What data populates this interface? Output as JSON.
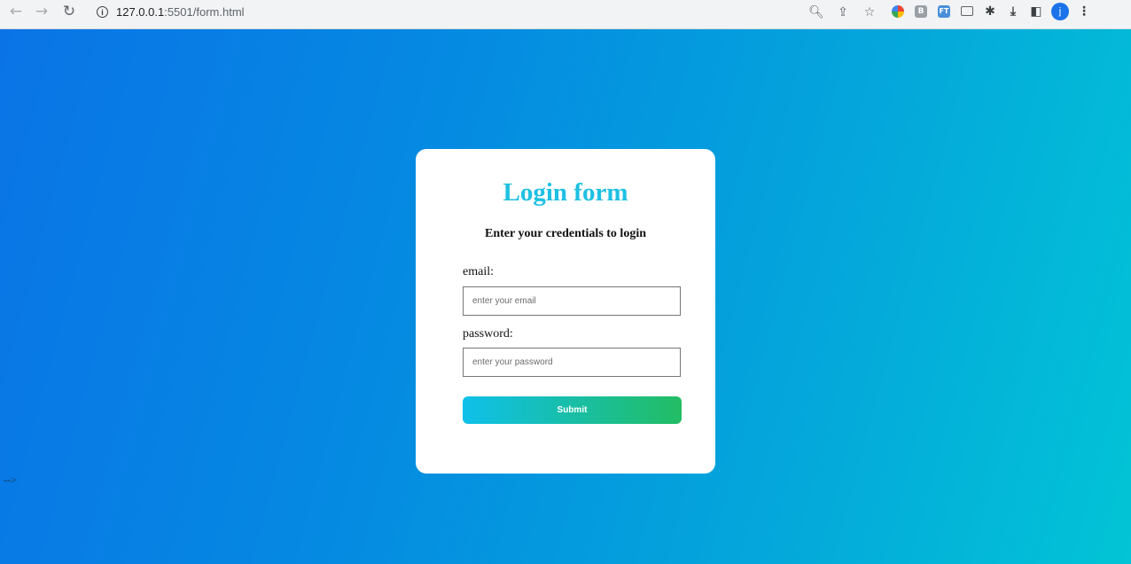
{
  "browser": {
    "url_host": "127.0.0.1",
    "url_path": ":5501/form.html",
    "nav_icons": [
      "back-arrow-icon",
      "forward-arrow-icon",
      "reload-icon"
    ],
    "omnibox_icons": [
      "zoom-icon",
      "share-icon",
      "bookmark-star-icon"
    ],
    "extension_b_label": "B",
    "extension_ft_label": "FT",
    "profile_initial": "j"
  },
  "page": {
    "stray_text": "-->"
  },
  "login": {
    "title": "Login form",
    "subtitle": "Enter your credentials to login",
    "email_label": "email:",
    "email_placeholder": "enter your email",
    "email_value": "",
    "password_label": "password:",
    "password_placeholder": "enter your password",
    "password_value": "",
    "submit_label": "Submit"
  },
  "colors": {
    "gradient_start": "#0a74e6",
    "gradient_end": "#02c4d6",
    "title": "#1ec0e2",
    "button_start": "#0fc0ea",
    "button_end": "#22bd63"
  }
}
